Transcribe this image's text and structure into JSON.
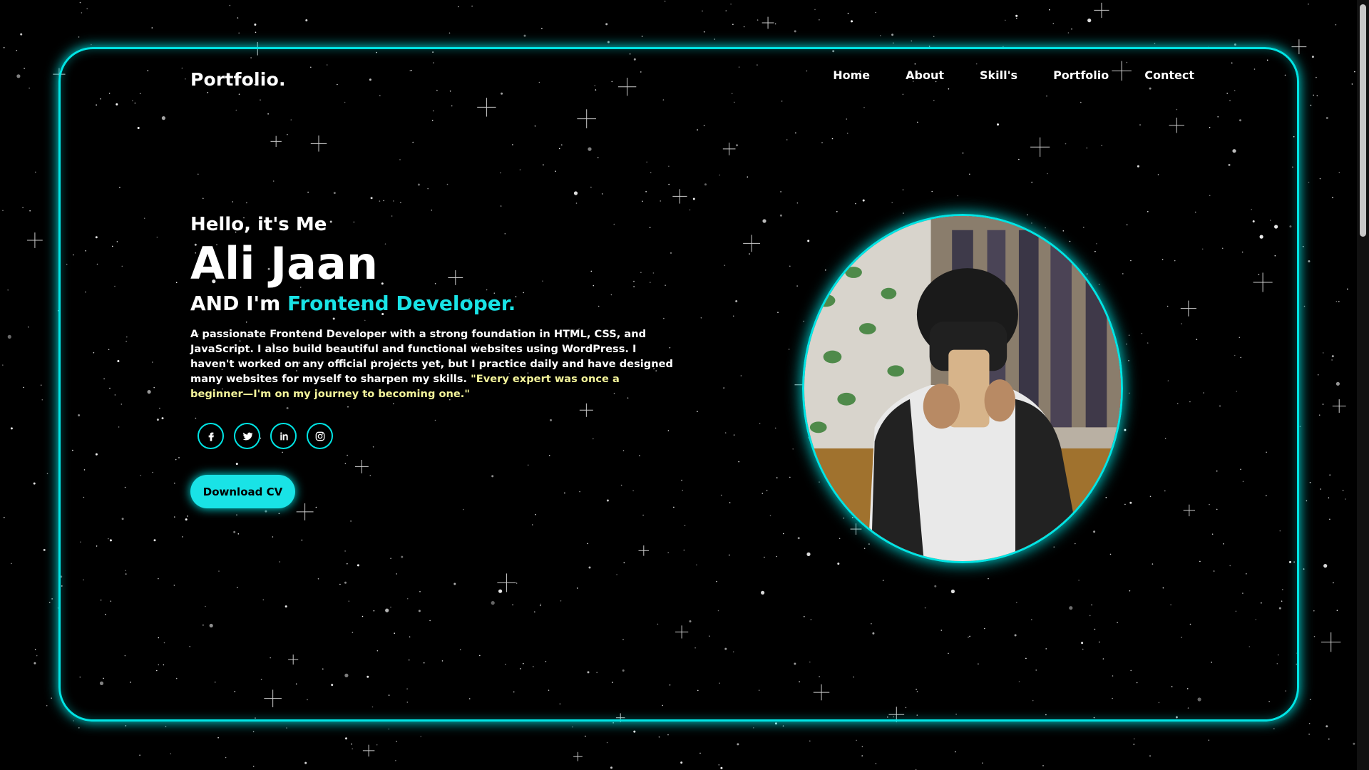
{
  "logo": "Portfolio.",
  "nav": {
    "home": "Home",
    "about": "About",
    "skills": "Skill's",
    "portfolio": "Portfolio",
    "contact": "Contect"
  },
  "hero": {
    "greeting": "Hello, it's Me",
    "name": "Ali Jaan",
    "role_prefix": "AND I'm",
    "role_accent": "Frontend Developer.",
    "description": "A passionate Frontend Developer with a strong foundation in HTML, CSS, and JavaScript. I also build beautiful and functional websites using WordPress. I haven't worked on any official projects yet, but I practice daily and have designed many websites for myself to sharpen my skills.",
    "quote": "\"Every expert was once a beginner—I'm on my journey to becoming one.\""
  },
  "social": {
    "icons": [
      "facebook-icon",
      "twitter-icon",
      "linkedin-icon",
      "instagram-icon"
    ]
  },
  "cta": {
    "download_cv": "Download CV"
  },
  "profile_photo": {
    "icon": "profile-photo"
  },
  "colors": {
    "accent": "#19e3e6",
    "background": "#000000",
    "quote": "#f4f49a",
    "text": "#ffffff"
  }
}
